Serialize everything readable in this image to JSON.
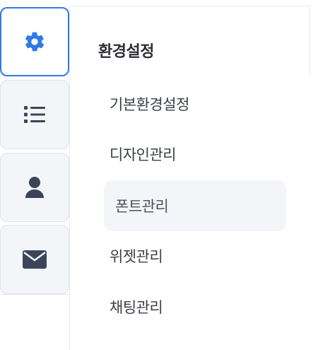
{
  "rail": {
    "items": [
      {
        "icon": "gear-icon",
        "active": true
      },
      {
        "icon": "list-icon",
        "active": false
      },
      {
        "icon": "user-icon",
        "active": false
      },
      {
        "icon": "envelope-icon",
        "active": false
      }
    ]
  },
  "colors": {
    "accent": "#2f7be5",
    "icon_dark": "#3b4557",
    "rail_bg": "#f3f5f8",
    "selected_bg": "#f4f5f8"
  },
  "panel": {
    "title": "환경설정",
    "items": [
      {
        "label": "기본환경설정",
        "selected": false
      },
      {
        "label": "디자인관리",
        "selected": false
      },
      {
        "label": "폰트관리",
        "selected": true
      },
      {
        "label": "위젯관리",
        "selected": false
      },
      {
        "label": "채팅관리",
        "selected": false
      }
    ]
  }
}
